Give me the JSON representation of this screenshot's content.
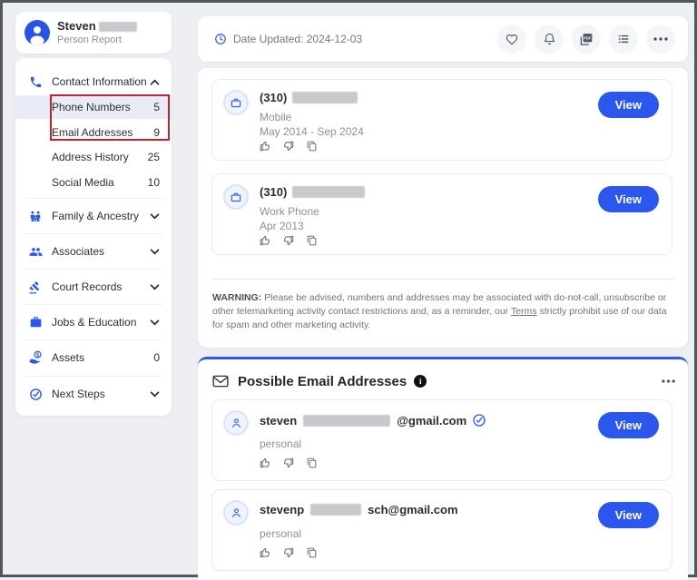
{
  "colors": {
    "primary_blue": "#2b57ee",
    "annotation_red": "#c8202f",
    "section_border_blue": "#2b59e8"
  },
  "sidebar": {
    "profile": {
      "name": "Steven",
      "subtitle": "Person Report"
    },
    "contact": {
      "label": "Contact Information",
      "items": [
        {
          "label": "Phone Numbers",
          "count": "5"
        },
        {
          "label": "Email Addresses",
          "count": "9"
        },
        {
          "label": "Address History",
          "count": "25"
        },
        {
          "label": "Social Media",
          "count": "10"
        }
      ]
    },
    "groups": [
      {
        "label": "Family & Ancestry"
      },
      {
        "label": "Associates"
      },
      {
        "label": "Court Records"
      },
      {
        "label": "Jobs & Education"
      },
      {
        "label": "Assets",
        "count": "0"
      },
      {
        "label": "Next Steps"
      }
    ]
  },
  "topbar": {
    "date_updated": "Date Updated: 2024-12-03"
  },
  "phones": {
    "cards": [
      {
        "prefix": "(310)",
        "type": "Mobile",
        "dates": "May 2014 - Sep 2024",
        "view": "View"
      },
      {
        "prefix": "(310)",
        "type": "Work Phone",
        "dates": "Apr 2013",
        "view": "View"
      }
    ],
    "warning": {
      "bold": "WARNING:",
      "t1": " Please be advised, numbers and addresses may be associated with do-not-call, unsubscribe or other telemarketing activity contact restrictions and, as a reminder, our ",
      "link": "Terms",
      "t2": " strictly prohibit use of our data for spam and other marketing activity."
    }
  },
  "emails": {
    "title": "Possible Email Addresses",
    "cards": [
      {
        "prefix": "steven",
        "suffix": "@gmail.com",
        "type": "personal",
        "view": "View",
        "verified": true
      },
      {
        "prefix": "stevenp",
        "suffix": "sch@gmail.com",
        "type": "personal",
        "view": "View",
        "verified": false
      }
    ]
  }
}
